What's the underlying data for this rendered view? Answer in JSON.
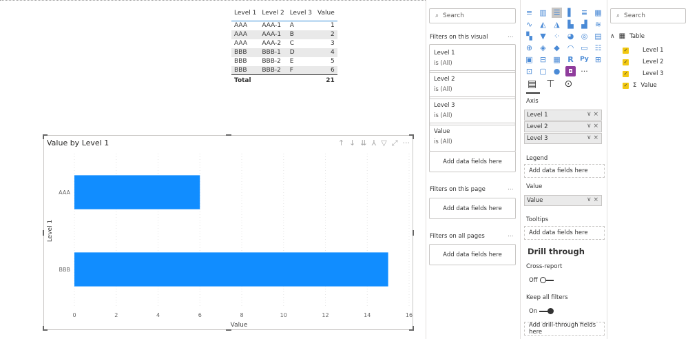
{
  "table_visual": {
    "headers": [
      "Level 1",
      "Level 2",
      "Level 3",
      "Value"
    ],
    "rows": [
      [
        "AAA",
        "AAA-1",
        "A",
        "1"
      ],
      [
        "AAA",
        "AAA-1",
        "B",
        "2"
      ],
      [
        "AAA",
        "AAA-2",
        "C",
        "3"
      ],
      [
        "BBB",
        "BBB-1",
        "D",
        "4"
      ],
      [
        "BBB",
        "BBB-2",
        "E",
        "5"
      ],
      [
        "BBB",
        "BBB-2",
        "F",
        "6"
      ]
    ],
    "total_label": "Total",
    "total_value": "21"
  },
  "chart_title": "Value by Level 1",
  "chart_data": {
    "type": "bar",
    "orientation": "horizontal",
    "categories": [
      "AAA",
      "BBB"
    ],
    "values": [
      6,
      15
    ],
    "xlabel": "Value",
    "ylabel": "Level 1",
    "xlim": [
      0,
      16
    ],
    "xticks": [
      0,
      2,
      4,
      6,
      8,
      10,
      12,
      14,
      16
    ],
    "grid": true,
    "bar_color": "#118dff"
  },
  "chart_header_icons": [
    "arrow-up-icon",
    "arrow-down-icon",
    "double-arrow-down-icon",
    "expand-hierarchy-icon",
    "filter-icon",
    "focus-mode-icon",
    "more-options-icon"
  ],
  "filters": {
    "search_placeholder": "Search",
    "on_visual_title": "Filters on this visual",
    "cards": [
      {
        "name": "Level 1",
        "state": "is (All)"
      },
      {
        "name": "Level 2",
        "state": "is (All)"
      },
      {
        "name": "Level 3",
        "state": "is (All)"
      },
      {
        "name": "Value",
        "state": "is (All)"
      }
    ],
    "add_fields": "Add data fields here",
    "on_page_title": "Filters on this page",
    "on_all_pages_title": "Filters on all pages",
    "more": "..."
  },
  "visualizations": {
    "wells": {
      "axis_label": "Axis",
      "axis_fields": [
        "Level 1",
        "Level 2",
        "Level 3"
      ],
      "legend_label": "Legend",
      "value_label": "Value",
      "value_fields": [
        "Value"
      ],
      "tooltips_label": "Tooltips",
      "add_fields": "Add data fields here"
    },
    "drill_through": {
      "title": "Drill through",
      "cross_report_label": "Cross-report",
      "cross_report_state": "Off",
      "keep_filters_label": "Keep all filters",
      "keep_filters_state": "On",
      "add_fields": "Add drill-through fields here"
    }
  },
  "fields": {
    "search_placeholder": "Search",
    "table_name": "Table",
    "columns": [
      "Level 1",
      "Level 2",
      "Level 3",
      "Value"
    ],
    "sigma": "Σ"
  },
  "colors": {
    "accent": "#118dff",
    "checkbox": "#f2c811"
  }
}
